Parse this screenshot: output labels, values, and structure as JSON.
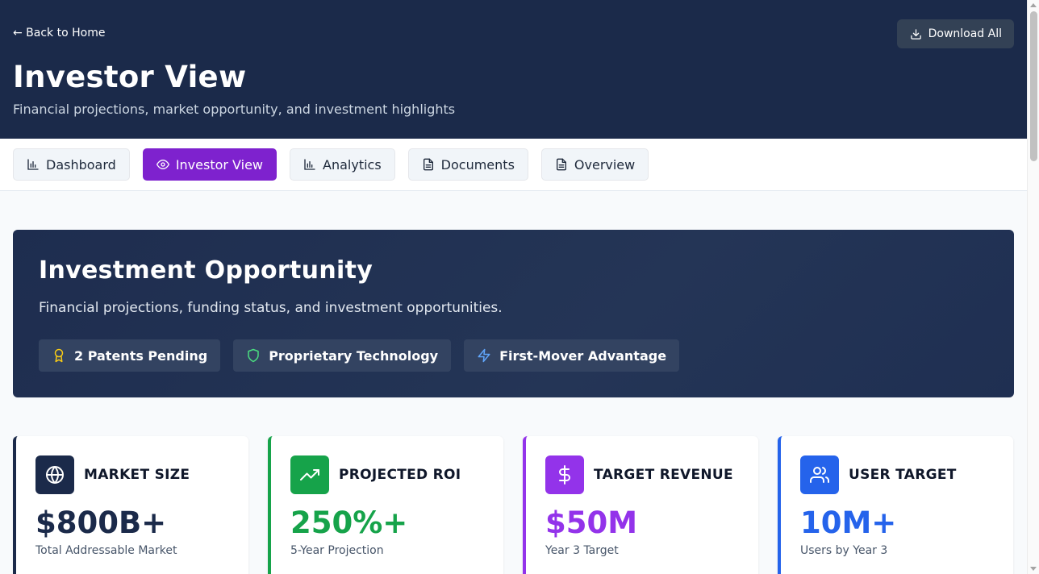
{
  "header": {
    "back_label": "← Back to Home",
    "download_label": "Download All",
    "title": "Investor View",
    "subtitle": "Financial projections, market opportunity, and investment highlights"
  },
  "tabs": [
    {
      "label": "Dashboard",
      "icon": "bar-chart-icon",
      "active": false
    },
    {
      "label": "Investor View",
      "icon": "eye-icon",
      "active": true
    },
    {
      "label": "Analytics",
      "icon": "bar-chart-icon",
      "active": false
    },
    {
      "label": "Documents",
      "icon": "file-icon",
      "active": false
    },
    {
      "label": "Overview",
      "icon": "file-icon",
      "active": false
    }
  ],
  "hero": {
    "title": "Investment Opportunity",
    "subtitle": "Financial projections, funding status, and investment opportunities.",
    "badges": [
      {
        "label": "2 Patents Pending",
        "icon": "award-icon",
        "color": "#facc15"
      },
      {
        "label": "Proprietary Technology",
        "icon": "shield-icon",
        "color": "#4ade80"
      },
      {
        "label": "First-Mover Advantage",
        "icon": "lightning-icon",
        "color": "#60a5fa"
      }
    ]
  },
  "stats": [
    {
      "label": "MARKET SIZE",
      "value": "$800B+",
      "caption": "Total Addressable Market",
      "color": "#1b2a4a",
      "icon": "globe-icon"
    },
    {
      "label": "PROJECTED ROI",
      "value": "250%+",
      "caption": "5-Year Projection",
      "color": "#16a34a",
      "icon": "trending-up-icon"
    },
    {
      "label": "TARGET REVENUE",
      "value": "$50M",
      "caption": "Year 3 Target",
      "color": "#9333ea",
      "icon": "dollar-icon"
    },
    {
      "label": "USER TARGET",
      "value": "10M+",
      "caption": "Users by Year 3",
      "color": "#2563eb",
      "icon": "users-icon"
    }
  ]
}
